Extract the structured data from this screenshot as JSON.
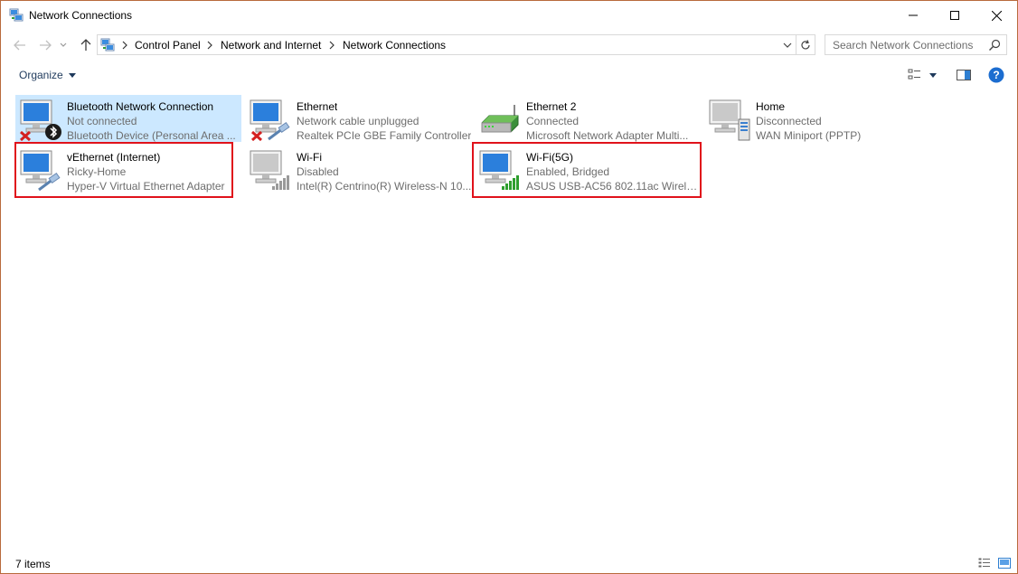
{
  "window": {
    "title": "Network Connections",
    "controls": {
      "minimize": "minimize",
      "maximize": "maximize",
      "close": "close"
    }
  },
  "address": {
    "crumbs": [
      "Control Panel",
      "Network and Internet",
      "Network Connections"
    ]
  },
  "search": {
    "placeholder": "Search Network Connections"
  },
  "toolbar": {
    "organize_label": "Organize"
  },
  "items": [
    {
      "name": "Bluetooth Network Connection",
      "status": "Not connected",
      "device": "Bluetooth Device (Personal Area ...",
      "icon": "monitor-bluetooth-icon",
      "badge": "red-x",
      "selected": true,
      "highlighted": false
    },
    {
      "name": "Ethernet",
      "status": "Network cable unplugged",
      "device": "Realtek PCIe GBE Family Controller",
      "icon": "monitor-cable-icon",
      "badge": "red-x",
      "selected": false,
      "highlighted": false
    },
    {
      "name": "Ethernet 2",
      "status": "Connected",
      "device": "Microsoft Network Adapter Multi...",
      "icon": "router-icon",
      "badge": "none",
      "selected": false,
      "highlighted": false
    },
    {
      "name": "Home",
      "status": "Disconnected",
      "device": "WAN Miniport (PPTP)",
      "icon": "monitor-tower-icon",
      "badge": "none",
      "selected": false,
      "highlighted": false
    },
    {
      "name": "vEthernet (Internet)",
      "status": "Ricky-Home",
      "device": "Hyper-V Virtual Ethernet Adapter",
      "icon": "monitor-cable-icon",
      "badge": "none",
      "selected": false,
      "highlighted": true
    },
    {
      "name": "Wi-Fi",
      "status": "Disabled",
      "device": "Intel(R) Centrino(R) Wireless-N 10...",
      "icon": "monitor-signal-gray-icon",
      "badge": "none",
      "selected": false,
      "highlighted": false
    },
    {
      "name": "Wi-Fi(5G)",
      "status": "Enabled, Bridged",
      "device": "ASUS USB-AC56 802.11ac Wireles...",
      "icon": "monitor-signal-green-icon",
      "badge": "none",
      "selected": false,
      "highlighted": true
    }
  ],
  "statusbar": {
    "count": "7 items"
  },
  "colors": {
    "accent": "#0078d7",
    "highlight_border": "#e0121b",
    "selection": "#cce8ff",
    "muted_text": "#6d6d6d"
  }
}
